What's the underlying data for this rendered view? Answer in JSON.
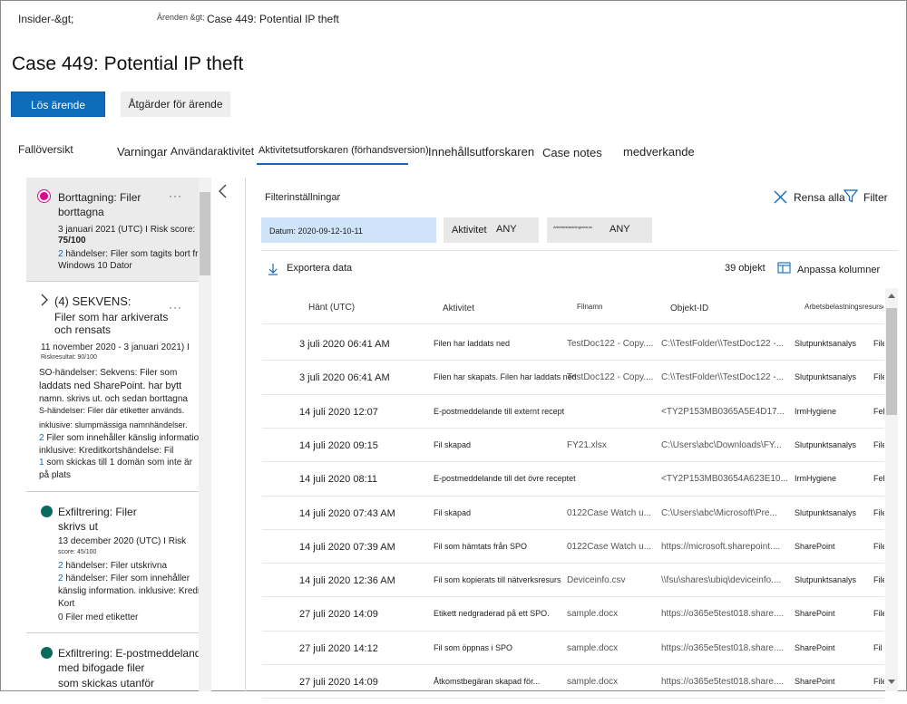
{
  "breadcrumb": {
    "root": "Insider-&gt;",
    "cases": "Ärenden &gt;",
    "current": "Case 449: Potential IP theft"
  },
  "page_title": "Case 449: Potential IP theft",
  "actions": {
    "resolve": "Lös ärende",
    "case_actions": "Åtgärder för ärende"
  },
  "tabs": {
    "overview": "Fallöversikt",
    "alerts": "Varningar",
    "user_activity": "Användaraktivitet",
    "activity_explorer": "Aktivitetsutforskaren (förhandsversion)",
    "content_explorer": "Innehållsutforskaren",
    "case_notes": "Case notes",
    "contributors": "medverkande"
  },
  "sequences": [
    {
      "title1": "Borttagning: Filer",
      "title2": "borttagna",
      "date": "3 januari 2021 (UTC) I Risk score:",
      "score": "75/100",
      "ev_num": "2",
      "ev_text": " händelser: Filer som tagits bort från",
      "ev_text2": "Windows 10 Dator",
      "dot_color": "#e3008c"
    },
    {
      "title1": "(4) SEKVENS:",
      "title2": "Filer som har arkiverats",
      "title3": "och rensats",
      "date": "11 november 2020 - 3 januari 2021) I",
      "score": "Riskresultat: 90/100",
      "lines": [
        "SO-händelser: Sekvens: Filer som",
        "laddats ned SharePoint. har bytt",
        "namn. skrivs ut. och sedan borttagna",
        "S-händelser: Filer där etiketter används.",
        "inklusive: slumpmässiga namnhändelser."
      ],
      "l6_num": "2",
      "l6": " Filer som innehåller känslig information,",
      "l7": "inklusive: Kreditkortshändelse: Fil",
      "l8_num": "1",
      "l8": " som skickas till 1 domän som inte är",
      "l9": "på plats"
    },
    {
      "title1": "Exfiltrering: Filer",
      "title2": "skrivs ut",
      "date": "13 december 2020 (UTC) I Risk",
      "score": "score: 45/100",
      "l1_num": "2",
      "l1": " händelser: Filer utskrivna",
      "l2_num": "2",
      "l2": " händelser: Filer som innehåller",
      "l3": "känslig information. inklusive: Kredit",
      "l4": "Kort",
      "l5": "0 Filer med etiketter",
      "dot_color": "#0b6a5e"
    },
    {
      "title1": "Exfiltrering: E-postmeddelanden",
      "title2": "med bifogade filer",
      "title3": "som skickas utanför",
      "dot_color": "#0b6a5e"
    }
  ],
  "filter": {
    "settings_label": "Filterinställningar",
    "clear_all": "Rensa alla",
    "filter_label": "Filter",
    "date_chip": "Datum: 2020-09-12-10-11",
    "activity_label": "Aktivitet",
    "activity_value": "ANY",
    "workload_label": "Arbetsbelastningsresurs",
    "workload_value": "ANY"
  },
  "toolbar": {
    "export": "Exportera data",
    "count": "39 objekt",
    "customize": "Anpassa kolumner"
  },
  "table": {
    "headers": [
      "Hänt (UTC)",
      "Aktivitet",
      "Filnamn",
      "Objekt-ID",
      "Arbetsbelastningsresurser"
    ],
    "rows": [
      {
        "time": "3 juli 2020 06:41 AM",
        "activity": "Filen har laddats ned",
        "file": "TestDoc122 - Copy....",
        "object": "C:\\\\TestFolder\\\\TestDoc122 -...",
        "workload": "Slutpunktsanalys",
        "extra": "File"
      },
      {
        "time": "3 juli 2020 06:41 AM",
        "activity": "Filen har skapats. Filen har laddats ned",
        "file": "TestDoc122 - Copy....",
        "object": "C:\\\\TestFolder\\\\TestDoc122 -...",
        "workload": "Slutpunktsanalys",
        "extra": "File"
      },
      {
        "time": "14 juli 2020 12:07",
        "activity": "E-postmeddelande till externt recept",
        "file": "",
        "object": "<TY2P153MB0365A5E4D17...",
        "workload": "IrmHygiene",
        "extra": "Fel"
      },
      {
        "time": "14 juli 2020 09:15",
        "activity": "Fil skapad",
        "file": "FY21.xlsx",
        "object": "C:\\Users\\abc\\Downloads\\FY...",
        "workload": "Slutpunktsanalys",
        "extra": "File"
      },
      {
        "time": "14 juli 2020 08:11",
        "activity": "E-postmeddelande till det övre receptet",
        "file": "",
        "object": "<TY2P153MB03654A623E10...",
        "workload": "IrmHygiene",
        "extra": "Fel"
      },
      {
        "time": "14 juli 2020 07:43 AM",
        "activity": "Fil skapad",
        "file": "0122Case Watch u...",
        "object": "C:\\Users\\abc\\Microsoft\\Pre...",
        "workload": "Slutpunktsanalys",
        "extra": "File"
      },
      {
        "time": "14 juli 2020 07:39 AM",
        "activity": "Fil som hämtats från SPO",
        "file": "0122Case Watch u...",
        "object": "https://microsoft.sharepoint....",
        "workload": "SharePoint",
        "extra": "File"
      },
      {
        "time": "14 juli 2020 12:36 AM",
        "activity": "Fil som kopierats till nätverksresurs",
        "file": "Deviceinfo.csv",
        "object": "\\\\fsu\\shares\\ubiq\\deviceinfo....",
        "workload": "Slutpunktsanalys",
        "extra": "File"
      },
      {
        "time": "27 juli 2020 14:09",
        "activity": "Etikett nedgraderad på ett SPO.",
        "file": "sample.docx",
        "object": "https://o365e5test018.share....",
        "workload": "SharePoint",
        "extra": "File"
      },
      {
        "time": "27 juli 2020 14:12",
        "activity": "Fil som öppnas i SPO",
        "file": "sample.docx",
        "object": "https://o365e5test018.share....",
        "workload": "SharePoint",
        "extra": "Fil"
      },
      {
        "time": "27 juli 2020 14:09",
        "activity": "Åtkomstbegäran skapad för...",
        "file": "sample.docx",
        "object": "https://o365e5test018.share....",
        "workload": "SharePoint",
        "extra": "File"
      }
    ]
  }
}
